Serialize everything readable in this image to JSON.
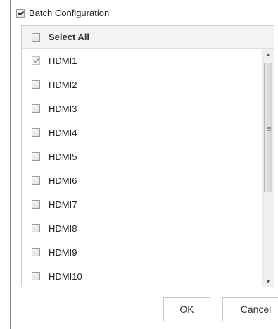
{
  "batch_configuration": {
    "label": "Batch Configuration",
    "checked": true
  },
  "select_all": {
    "label": "Select All",
    "checked": false
  },
  "channels": [
    {
      "label": "HDMI1",
      "checked": true,
      "disabled": true
    },
    {
      "label": "HDMI2",
      "checked": false
    },
    {
      "label": "HDMI3",
      "checked": false
    },
    {
      "label": "HDMI4",
      "checked": false
    },
    {
      "label": "HDMI5",
      "checked": false
    },
    {
      "label": "HDMI6",
      "checked": false
    },
    {
      "label": "HDMI7",
      "checked": false
    },
    {
      "label": "HDMI8",
      "checked": false
    },
    {
      "label": "HDMI9",
      "checked": false
    },
    {
      "label": "HDMI10",
      "checked": false
    }
  ],
  "icons": {
    "scroll_up": "scroll-up-arrow-icon",
    "scroll_down": "scroll-down-arrow-icon",
    "grip": "scroll-grip-icon"
  },
  "buttons": {
    "ok": "OK",
    "cancel": "Cancel"
  }
}
